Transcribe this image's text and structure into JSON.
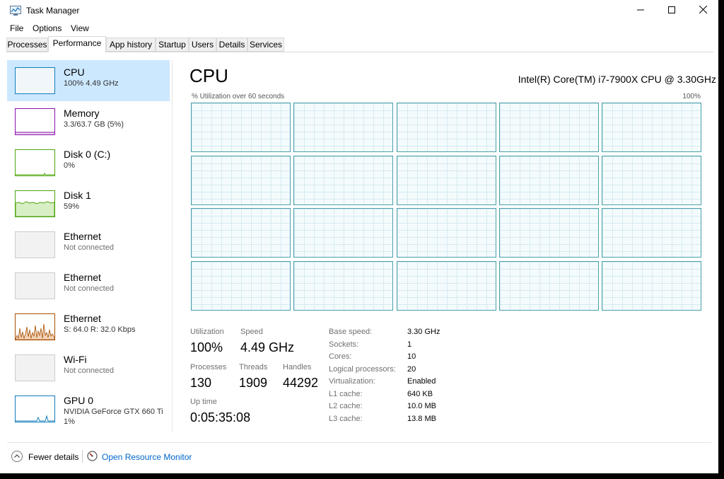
{
  "window": {
    "title": "Task Manager",
    "minimize_icon": "minimize-icon",
    "maximize_icon": "maximize-icon",
    "close_icon": "close-icon"
  },
  "menu": [
    "File",
    "Options",
    "View"
  ],
  "tabs": [
    "Processes",
    "Performance",
    "App history",
    "Startup",
    "Users",
    "Details",
    "Services"
  ],
  "active_tab": "Performance",
  "sidebar": [
    {
      "name": "CPU",
      "sub": "100%  4.49 GHz",
      "color": "#117dbb"
    },
    {
      "name": "Memory",
      "sub": "3.3/63.7 GB (5%)",
      "color": "#8b12ae"
    },
    {
      "name": "Disk 0 (C:)",
      "sub": "0%",
      "color": "#4da60c"
    },
    {
      "name": "Disk 1",
      "sub": "59%",
      "color": "#4da60c"
    },
    {
      "name": "Ethernet",
      "sub": "Not connected",
      "color": "#a74f01"
    },
    {
      "name": "Ethernet",
      "sub": "Not connected",
      "color": "#a74f01"
    },
    {
      "name": "Ethernet",
      "sub": "S: 64.0  R: 32.0 Kbps",
      "color": "#a74f01"
    },
    {
      "name": "Wi-Fi",
      "sub": "Not connected",
      "color": "#a74f01"
    },
    {
      "name": "GPU 0",
      "sub": "NVIDIA GeForce GTX 660 Ti",
      "sub2": "1%",
      "color": "#117dbb"
    }
  ],
  "main": {
    "title": "CPU",
    "cpu_model": "Intel(R) Core(TM) i7-7900X CPU @ 3.30GHz",
    "graph_label": "% Utilization over 60 seconds",
    "graph_max": "100%",
    "graph_color": "#117dbb",
    "logical_graph_count": 20,
    "stats": {
      "utilization_label": "Utilization",
      "utilization": "100%",
      "speed_label": "Speed",
      "speed": "4.49 GHz",
      "processes_label": "Processes",
      "processes": "130",
      "threads_label": "Threads",
      "threads": "1909",
      "handles_label": "Handles",
      "handles": "44292",
      "uptime_label": "Up time",
      "uptime": "0:05:35:08"
    },
    "details": [
      {
        "label": "Base speed:",
        "value": "3.30 GHz"
      },
      {
        "label": "Sockets:",
        "value": "1"
      },
      {
        "label": "Cores:",
        "value": "10"
      },
      {
        "label": "Logical processors:",
        "value": "20"
      },
      {
        "label": "Virtualization:",
        "value": "Enabled"
      },
      {
        "label": "L1 cache:",
        "value": "640 KB"
      },
      {
        "label": "L2 cache:",
        "value": "10.0 MB"
      },
      {
        "label": "L3 cache:",
        "value": "13.8 MB"
      }
    ]
  },
  "footer": {
    "fewer_details": "Fewer details",
    "open_resource_monitor": "Open Resource Monitor"
  }
}
